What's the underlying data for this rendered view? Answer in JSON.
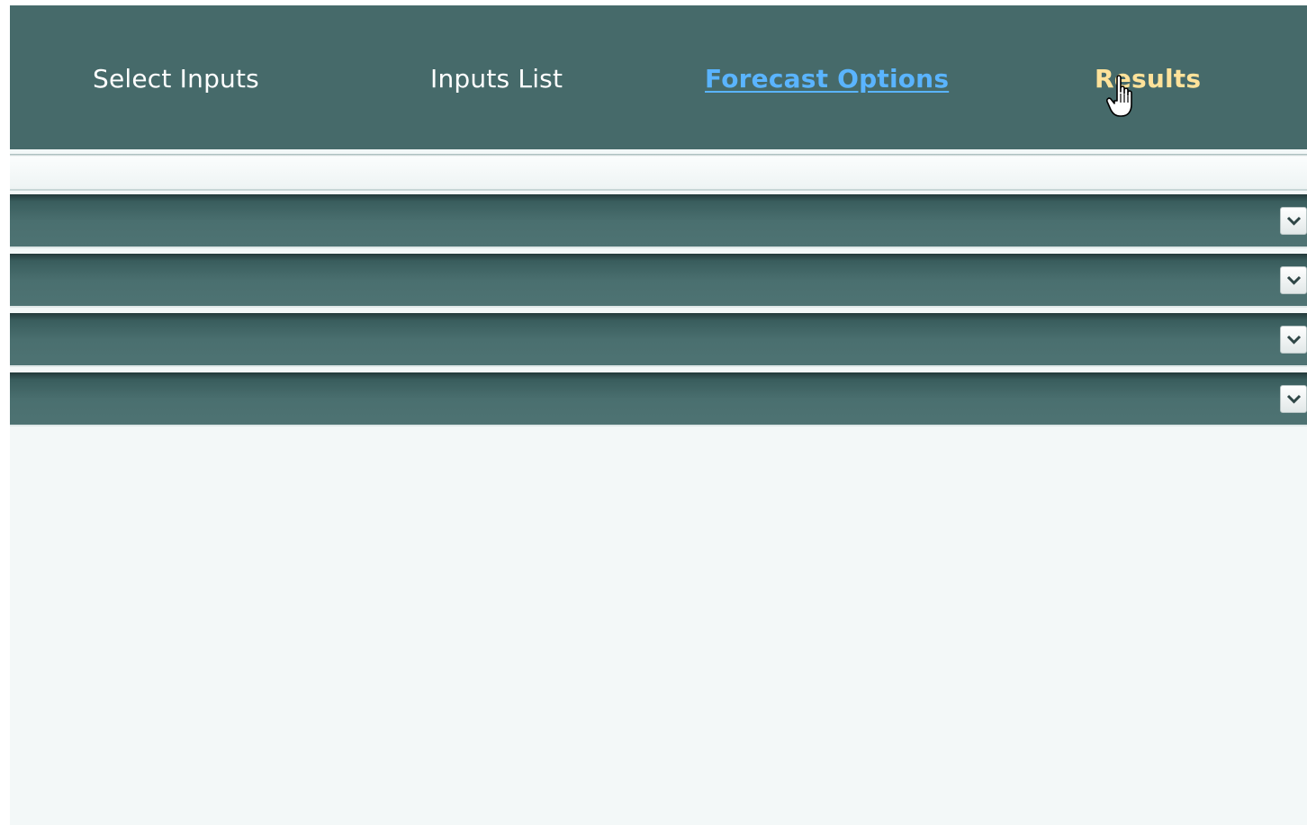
{
  "nav": {
    "items": [
      {
        "label": "Select Inputs"
      },
      {
        "label": "Inputs List"
      },
      {
        "label": "Forecast Options"
      },
      {
        "label": "Results"
      }
    ],
    "active": "Forecast Options",
    "hovered": "Results"
  },
  "panels": [
    {
      "icon": "chevron-down-icon"
    },
    {
      "icon": "chevron-down-icon"
    },
    {
      "icon": "chevron-down-icon"
    },
    {
      "icon": "chevron-down-icon"
    }
  ],
  "colors": {
    "nav_background": "#466a6a",
    "nav_text": "#ffffff",
    "active_link": "#5ab4ff",
    "hover_link": "#ffe29a",
    "panel_header": "#4a6f6f",
    "page_background": "#f3f8f8"
  }
}
